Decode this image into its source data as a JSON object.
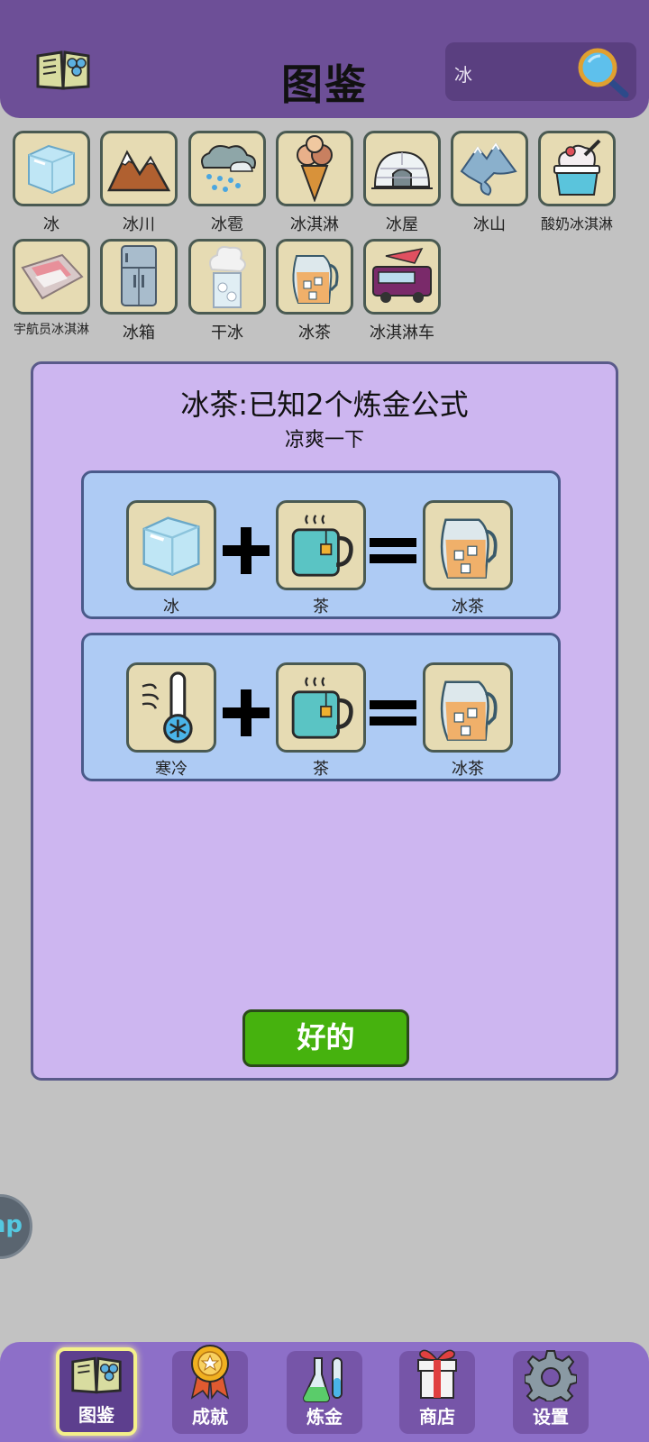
{
  "header": {
    "title": "图鉴",
    "search_value": "冰"
  },
  "items": [
    {
      "label": "冰",
      "icon": "ice-cube-icon"
    },
    {
      "label": "冰川",
      "icon": "glacier-icon"
    },
    {
      "label": "冰雹",
      "icon": "hail-cloud-icon"
    },
    {
      "label": "冰淇淋",
      "icon": "ice-cream-cone-icon"
    },
    {
      "label": "冰屋",
      "icon": "igloo-icon"
    },
    {
      "label": "冰山",
      "icon": "iceberg-icon"
    },
    {
      "label": "酸奶冰淇淋",
      "icon": "frozen-yogurt-icon"
    },
    {
      "label": "宇航员冰淇淋",
      "icon": "astronaut-ice-cream-icon"
    },
    {
      "label": "冰箱",
      "icon": "refrigerator-icon"
    },
    {
      "label": "干冰",
      "icon": "dry-ice-icon"
    },
    {
      "label": "冰茶",
      "icon": "iced-tea-icon"
    },
    {
      "label": "冰淇淋车",
      "icon": "ice-cream-truck-icon"
    }
  ],
  "dialog": {
    "title": "冰茶:已知2个炼金公式",
    "subtitle": "凉爽一下",
    "recipes": [
      {
        "a": "冰",
        "b": "茶",
        "result": "冰茶"
      },
      {
        "a": "寒冷",
        "b": "茶",
        "result": "冰茶"
      }
    ],
    "ok_label": "好的"
  },
  "side_button": {
    "label": "ap"
  },
  "nav": [
    {
      "label": "图鉴",
      "icon": "book-icon",
      "active": true
    },
    {
      "label": "成就",
      "icon": "medal-icon"
    },
    {
      "label": "炼金",
      "icon": "flask-icon"
    },
    {
      "label": "商店",
      "icon": "gift-icon"
    },
    {
      "label": "设置",
      "icon": "gear-icon"
    }
  ],
  "colors": {
    "header": "#6d4f97",
    "dialog": "#cdb6f0",
    "recipe": "#aecbf4",
    "ok_button": "#46b20e",
    "nav": "#8d6fc8"
  }
}
